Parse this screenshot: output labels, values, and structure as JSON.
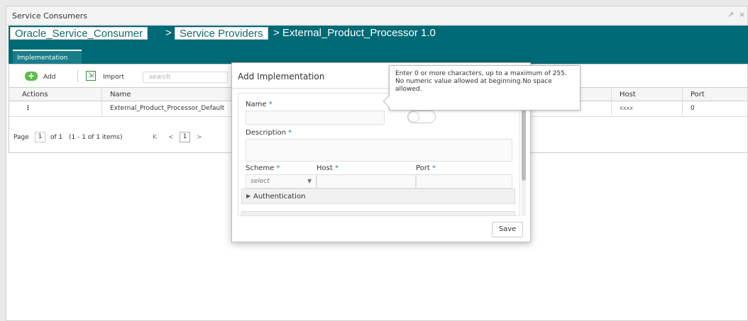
{
  "window": {
    "title": "Service Consumers",
    "controls": {
      "maximize": "↗",
      "close": "×"
    }
  },
  "breadcrumb": {
    "item1": "Oracle_Service_Consumer",
    "sep": ">",
    "item2": "Service Providers",
    "current": "> External_Product_Processor 1.0"
  },
  "tabs": {
    "implementation": "Implementation"
  },
  "toolbar": {
    "add_label": "Add",
    "add_icon": "+",
    "import_label": "Import",
    "import_icon": "⇲",
    "search_placeholder": "search"
  },
  "table": {
    "headers": {
      "actions": "Actions",
      "name": "Name",
      "host": "Host",
      "port": "Port"
    },
    "rows": [
      {
        "action": "⋮",
        "name": "External_Product_Processor_Default",
        "host": "xxxx",
        "port": "0"
      }
    ]
  },
  "pager": {
    "page_label": "Page",
    "page_value": "1",
    "of_text": "of 1",
    "items_text": "(1 - 1 of 1 items)",
    "first": "K",
    "prev": "<",
    "current": "1",
    "next": ">"
  },
  "modal": {
    "title": "Add Implementation",
    "name_label": "Name",
    "description_label": "Description",
    "scheme_label": "Scheme",
    "host_label": "Host",
    "port_label": "Port",
    "required_mark": "*",
    "scheme_value": "select",
    "caret": "▼",
    "authentication_label": "Authentication",
    "collapse_arrow": "▶",
    "save_label": "Save"
  },
  "tooltip": {
    "line1": "Enter 0 or more characters, up to a maximum of 255.",
    "line2": "No numeric value allowed at beginning.No space allowed."
  },
  "colors": {
    "header_teal": "#006a76",
    "tab_teal": "#187e89",
    "add_green": "#5fbb4a"
  }
}
